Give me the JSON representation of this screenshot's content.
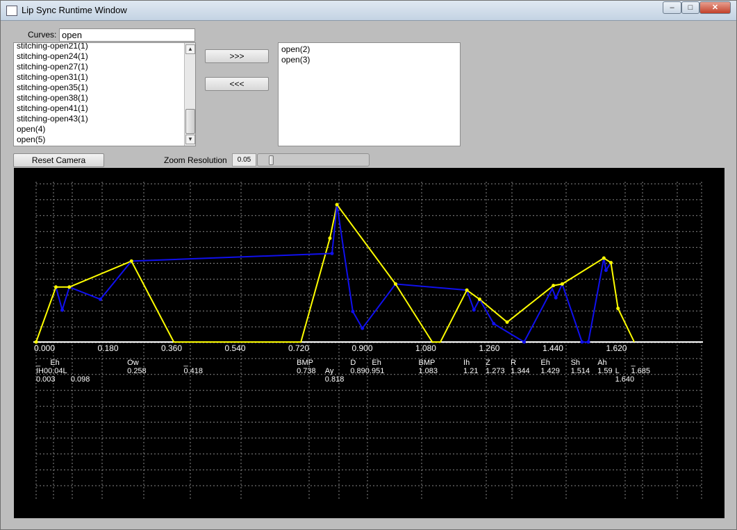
{
  "window": {
    "title": "Lip Sync Runtime Window",
    "min": "‒",
    "max": "□",
    "close": "✕"
  },
  "curves": {
    "label": "Curves:",
    "filter_value": "open",
    "available": [
      "stitching-open21(1)",
      "stitching-open24(1)",
      "stitching-open27(1)",
      "stitching-open31(1)",
      "stitching-open35(1)",
      "stitching-open38(1)",
      "stitching-open41(1)",
      "stitching-open43(1)",
      "open(4)",
      "open(5)"
    ],
    "selected": [
      "open(2)",
      "open(3)"
    ],
    "add_label": ">>>",
    "remove_label": "<<<"
  },
  "controls": {
    "reset_camera": "Reset Camera",
    "zoom_label": "Zoom Resolution",
    "zoom_value": "0.05"
  },
  "chart_data": {
    "type": "line",
    "axis_ticks": [
      "0.000",
      "0.180",
      "0.360",
      "0.540",
      "0.720",
      "0.900",
      "1.080",
      "1.260",
      "1.440",
      "1.620"
    ],
    "x_range": [
      0,
      1.8
    ],
    "colors": {
      "yellow": "#ffff00",
      "blue": "#1010ee",
      "axis": "#ffffff",
      "grid": "#8a8a8a"
    },
    "phonemes": [
      {
        "label": "_",
        "t": 0.0,
        "row": 1
      },
      {
        "label": "Eh",
        "t": 0.04,
        "row": 1
      },
      {
        "label": "Ow",
        "t": 0.258,
        "row": 1
      },
      {
        "label": "_",
        "t": 0.418,
        "row": 1
      },
      {
        "label": "BMP",
        "t": 0.738,
        "row": 1
      },
      {
        "label": "D",
        "t": 0.89,
        "row": 1
      },
      {
        "label": "Eh",
        "t": 0.951,
        "row": 1
      },
      {
        "label": "BMP",
        "t": 1.083,
        "row": 1
      },
      {
        "label": "Ih",
        "t": 1.21,
        "row": 1
      },
      {
        "label": "Z",
        "t": 1.273,
        "row": 1
      },
      {
        "label": "R",
        "t": 1.344,
        "row": 1
      },
      {
        "label": "Eh",
        "t": 1.429,
        "row": 1
      },
      {
        "label": "Sh",
        "t": 1.514,
        "row": 1
      },
      {
        "label": "Ah",
        "t": 1.59,
        "row": 1
      },
      {
        "label": "_",
        "t": 1.685,
        "row": 1
      },
      {
        "label": "Ay",
        "t": 0.818,
        "row": 2
      },
      {
        "label": "L",
        "t": 1.64,
        "row": 2
      }
    ],
    "time_labels": [
      {
        "text": "IH00.04L",
        "pos": 0.0,
        "row": 2
      },
      {
        "text": "0.258",
        "pos": 0.258,
        "row": 2
      },
      {
        "text": "0.418",
        "pos": 0.418,
        "row": 2
      },
      {
        "text": "0.738",
        "pos": 0.738,
        "row": 2
      },
      {
        "text": "0.818",
        "pos": 0.818,
        "row": 3
      },
      {
        "text": "0.890.951",
        "pos": 0.89,
        "row": 2
      },
      {
        "text": "1.083",
        "pos": 1.083,
        "row": 2
      },
      {
        "text": "1.21",
        "pos": 1.21,
        "row": 2
      },
      {
        "text": "1.273",
        "pos": 1.273,
        "row": 2
      },
      {
        "text": "1.344",
        "pos": 1.344,
        "row": 2
      },
      {
        "text": "1.429",
        "pos": 1.429,
        "row": 2
      },
      {
        "text": "1.514",
        "pos": 1.514,
        "row": 2
      },
      {
        "text": "1.59",
        "pos": 1.59,
        "row": 2
      },
      {
        "text": "1.685",
        "pos": 1.685,
        "row": 2
      },
      {
        "text": "0.003",
        "pos": 0.0,
        "row": 3
      },
      {
        "text": "0.098",
        "pos": 0.098,
        "row": 3
      },
      {
        "text": "1.640",
        "pos": 1.64,
        "row": 3
      }
    ],
    "series": [
      {
        "color": "yellow",
        "points": [
          [
            0.0,
            0.0
          ],
          [
            0.056,
            0.36
          ],
          [
            0.094,
            0.36
          ],
          [
            0.27,
            0.53
          ],
          [
            0.39,
            0.0
          ],
          [
            0.75,
            0.0
          ],
          [
            0.832,
            0.68
          ],
          [
            0.852,
            0.9
          ],
          [
            1.018,
            0.38
          ],
          [
            1.122,
            0.0
          ],
          [
            1.145,
            0.0
          ],
          [
            1.22,
            0.34
          ],
          [
            1.256,
            0.28
          ],
          [
            1.334,
            0.13
          ],
          [
            1.465,
            0.37
          ],
          [
            1.49,
            0.38
          ],
          [
            1.608,
            0.55
          ],
          [
            1.628,
            0.52
          ],
          [
            1.648,
            0.22
          ],
          [
            1.694,
            0.0
          ]
        ],
        "markers": [
          [
            0.0,
            0.0
          ],
          [
            0.056,
            0.36
          ],
          [
            0.094,
            0.36
          ],
          [
            0.27,
            0.53
          ],
          [
            0.832,
            0.68
          ],
          [
            0.852,
            0.9
          ],
          [
            1.018,
            0.38
          ],
          [
            1.22,
            0.34
          ],
          [
            1.256,
            0.28
          ],
          [
            1.334,
            0.13
          ],
          [
            1.465,
            0.37
          ],
          [
            1.49,
            0.38
          ],
          [
            1.608,
            0.55
          ],
          [
            1.628,
            0.52
          ],
          [
            1.648,
            0.22
          ]
        ]
      },
      {
        "color": "blue",
        "points": [
          [
            0.056,
            0.36
          ],
          [
            0.074,
            0.21
          ],
          [
            0.094,
            0.36
          ],
          [
            0.182,
            0.28
          ],
          [
            0.27,
            0.53
          ],
          [
            0.838,
            0.58
          ],
          [
            0.852,
            0.9
          ],
          [
            0.897,
            0.2
          ],
          [
            0.924,
            0.09
          ],
          [
            1.018,
            0.38
          ],
          [
            1.22,
            0.34
          ],
          [
            1.24,
            0.21
          ],
          [
            1.256,
            0.28
          ],
          [
            1.296,
            0.12
          ],
          [
            1.382,
            0.0
          ],
          [
            1.462,
            0.35
          ],
          [
            1.472,
            0.29
          ],
          [
            1.49,
            0.38
          ],
          [
            1.546,
            0.0
          ],
          [
            1.564,
            0.0
          ],
          [
            1.608,
            0.55
          ],
          [
            1.614,
            0.47
          ],
          [
            1.628,
            0.52
          ]
        ],
        "markers": [
          [
            0.074,
            0.21
          ],
          [
            0.182,
            0.28
          ],
          [
            0.838,
            0.58
          ],
          [
            0.897,
            0.2
          ],
          [
            0.924,
            0.09
          ],
          [
            1.24,
            0.21
          ],
          [
            1.296,
            0.12
          ],
          [
            1.382,
            0.0
          ],
          [
            1.472,
            0.29
          ],
          [
            1.546,
            0.0
          ],
          [
            1.564,
            0.0
          ],
          [
            1.614,
            0.47
          ]
        ]
      }
    ]
  }
}
